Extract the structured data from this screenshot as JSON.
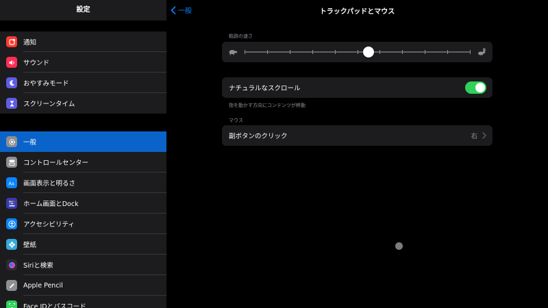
{
  "sidebar": {
    "title": "設定",
    "group1": [
      {
        "label": "通知",
        "icon": "bell-icon",
        "color": "#ff3b30"
      },
      {
        "label": "サウンド",
        "icon": "speaker-icon",
        "color": "#ff2d55"
      },
      {
        "label": "おやすみモード",
        "icon": "moon-icon",
        "color": "#5e5ce6"
      },
      {
        "label": "スクリーンタイム",
        "icon": "hourglass-icon",
        "color": "#5e5ce6"
      }
    ],
    "group2": [
      {
        "label": "一般",
        "icon": "gear-icon",
        "color": "#8e8e93",
        "selected": true
      },
      {
        "label": "コントロールセンター",
        "icon": "toggles-icon",
        "color": "#8e8e93"
      },
      {
        "label": "画面表示と明るさ",
        "icon": "text-size-icon",
        "color": "#0a84ff"
      },
      {
        "label": "ホーム画面とDock",
        "icon": "home-grid-icon",
        "color": "#3a3ab5"
      },
      {
        "label": "アクセシビリティ",
        "icon": "accessibility-icon",
        "color": "#0a84ff"
      },
      {
        "label": "壁紙",
        "icon": "flower-icon",
        "color": "#34aadc"
      },
      {
        "label": "Siriと検索",
        "icon": "siri-icon",
        "color": "#2c2c2e"
      },
      {
        "label": "Apple Pencil",
        "icon": "pencil-icon",
        "color": "#8e8e93"
      },
      {
        "label": "Face IDとパスコード",
        "icon": "faceid-icon",
        "color": "#30d158"
      }
    ]
  },
  "nav": {
    "back_label": "一般",
    "title": "トラックパッドとマウス"
  },
  "tracking": {
    "caption": "軌跡の速さ",
    "value_fraction": 0.55,
    "tick_count": 11,
    "slow_icon": "turtle-icon",
    "fast_icon": "rabbit-icon"
  },
  "natural_scroll": {
    "label": "ナチュラルなスクロール",
    "enabled": true,
    "footer": "指を動かす方向にコンテンツが移動"
  },
  "mouse": {
    "caption": "マウス",
    "secondary_click_label": "副ボタンのクリック",
    "secondary_click_value": "右"
  },
  "colors": {
    "accent": "#0a84ff",
    "selected_row": "#0a63c9",
    "toggle_on": "#30d158"
  }
}
